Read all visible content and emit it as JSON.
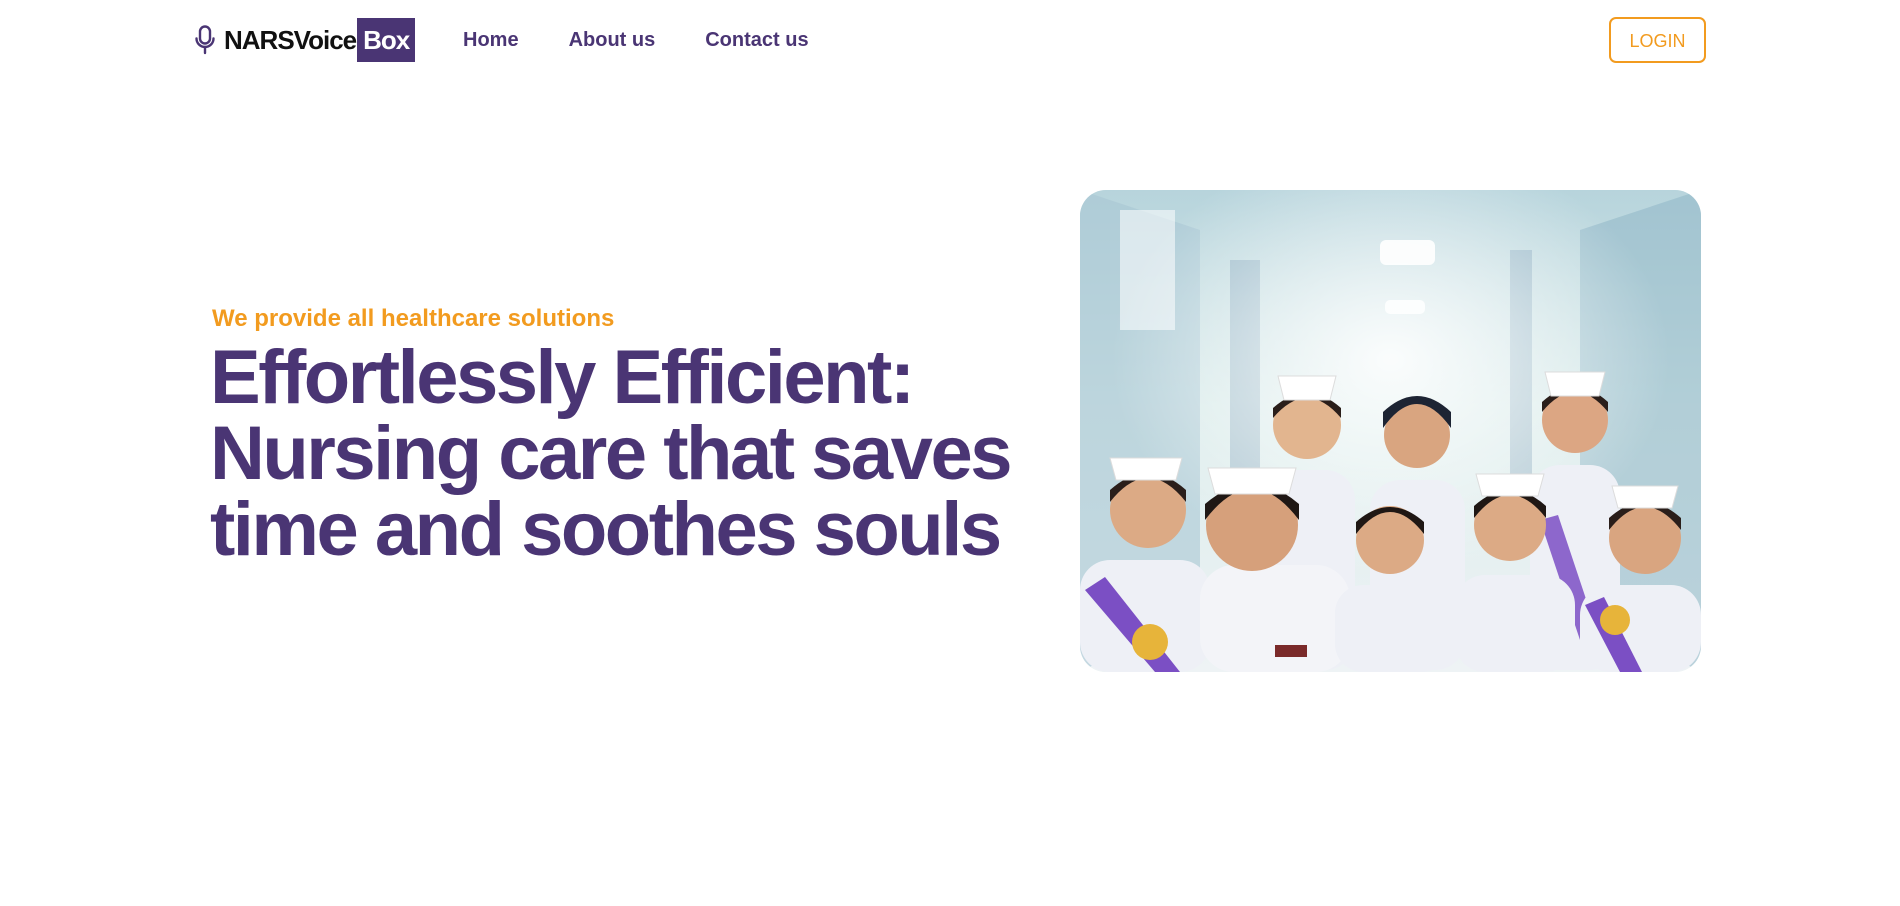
{
  "header": {
    "logo": {
      "icon": "microphone-icon",
      "brand_main": "NARSVoice",
      "brand_box": "Box"
    },
    "nav": [
      {
        "label": "Home"
      },
      {
        "label": "About us"
      },
      {
        "label": "Contact us"
      }
    ],
    "login_label": "LOGIN"
  },
  "hero": {
    "tagline": "We provide all healthcare solutions",
    "title_lines": [
      "Effortlessly Efficient:",
      "Nursing care that saves",
      "time and soothes souls"
    ],
    "image": "group-of-nurses-in-hospital-corridor"
  },
  "colors": {
    "brand_purple": "#4a3574",
    "accent_orange": "#f29b1f",
    "background": "#ffffff"
  }
}
